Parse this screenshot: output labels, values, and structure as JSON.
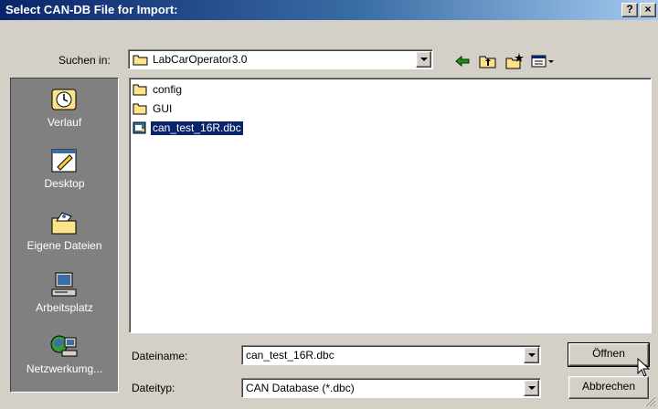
{
  "window": {
    "title": "Select CAN-DB File for Import:",
    "help_label": "?",
    "close_label": "×"
  },
  "lookin": {
    "label": "Suchen in:",
    "value": "LabCarOperator3.0"
  },
  "toolbar": {
    "back_icon": "back-arrow-icon",
    "up_icon": "up-folder-icon",
    "new_folder_icon": "new-folder-icon",
    "view_icon": "view-menu-icon"
  },
  "places": [
    {
      "label": "Verlauf",
      "icon": "history-icon"
    },
    {
      "label": "Desktop",
      "icon": "desktop-icon"
    },
    {
      "label": "Eigene Dateien",
      "icon": "my-documents-icon"
    },
    {
      "label": "Arbeitsplatz",
      "icon": "my-computer-icon"
    },
    {
      "label": "Netzwerkumg...",
      "icon": "network-icon"
    }
  ],
  "files": [
    {
      "name": "config",
      "type": "folder"
    },
    {
      "name": "GUI",
      "type": "folder"
    },
    {
      "name": "can_test_16R.dbc",
      "type": "file",
      "selected": true
    }
  ],
  "filename": {
    "label": "Dateiname:",
    "value": "can_test_16R.dbc"
  },
  "filetype": {
    "label": "Dateityp:",
    "value": "CAN Database (*.dbc)"
  },
  "buttons": {
    "open": "Öffnen",
    "cancel": "Abbrechen"
  },
  "colors": {
    "title_start": "#0a246a",
    "title_end": "#a6caf0",
    "selection": "#0a246a",
    "face": "#d4d0c8"
  }
}
